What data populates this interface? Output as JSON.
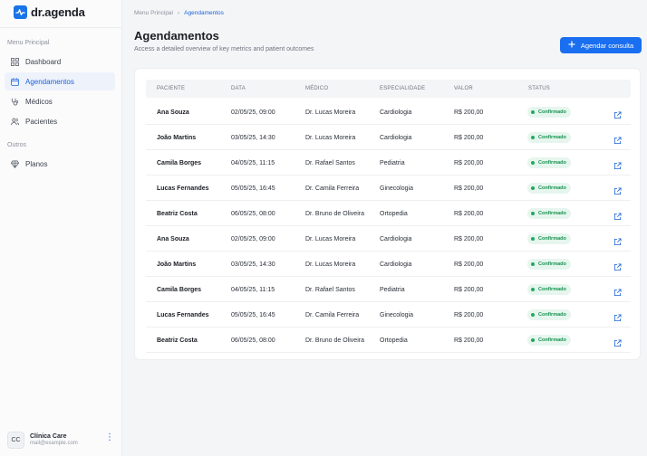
{
  "app": {
    "brand": "dr.agenda"
  },
  "sidebar": {
    "section_main": "Menu Principal",
    "section_other": "Outros",
    "items": [
      {
        "label": "Dashboard",
        "icon": "grid-icon"
      },
      {
        "label": "Agendamentos",
        "icon": "calendar-icon",
        "active": true
      },
      {
        "label": "Médicos",
        "icon": "stethoscope-icon"
      },
      {
        "label": "Pacientes",
        "icon": "users-icon"
      }
    ],
    "other_items": [
      {
        "label": "Planos",
        "icon": "gem-icon"
      }
    ],
    "user": {
      "initials": "CC",
      "name": "Clínica Care",
      "email": "mail@example.com"
    }
  },
  "breadcrumb": {
    "parent": "Menu Principal",
    "current": "Agendamentos"
  },
  "header": {
    "title": "Agendamentos",
    "subtitle": "Access a detailed overview of key metrics and patient outcomes",
    "action_label": "Agendar consulta"
  },
  "table": {
    "columns": [
      "PACIENTE",
      "DATA",
      "MÉDICO",
      "ESPECIALIDADE",
      "VALOR",
      "STATUS"
    ],
    "rows": [
      {
        "paciente": "Ana Souza",
        "data": "02/05/25, 09:00",
        "medico": "Dr. Lucas Moreira",
        "especialidade": "Cardiologia",
        "valor": "R$ 200,00",
        "status": "Confirmado"
      },
      {
        "paciente": "João Martins",
        "data": "03/05/25, 14:30",
        "medico": "Dr. Lucas Moreira",
        "especialidade": "Cardiologia",
        "valor": "R$ 200,00",
        "status": "Confirmado"
      },
      {
        "paciente": "Camila Borges",
        "data": "04/05/25, 11:15",
        "medico": "Dr. Rafael Santos",
        "especialidade": "Pediatria",
        "valor": "R$ 200,00",
        "status": "Confirmado"
      },
      {
        "paciente": "Lucas Fernandes",
        "data": "05/05/25, 16:45",
        "medico": "Dr. Camila Ferreira",
        "especialidade": "Ginecologia",
        "valor": "R$ 200,00",
        "status": "Confirmado"
      },
      {
        "paciente": "Beatriz Costa",
        "data": "06/05/25, 08:00",
        "medico": "Dr. Bruno de Oliveira",
        "especialidade": "Ortopedia",
        "valor": "R$ 200,00",
        "status": "Confirmado"
      },
      {
        "paciente": "Ana Souza",
        "data": "02/05/25, 09:00",
        "medico": "Dr. Lucas Moreira",
        "especialidade": "Cardiologia",
        "valor": "R$ 200,00",
        "status": "Confirmado"
      },
      {
        "paciente": "João Martins",
        "data": "03/05/25, 14:30",
        "medico": "Dr. Lucas Moreira",
        "especialidade": "Cardiologia",
        "valor": "R$ 200,00",
        "status": "Confirmado"
      },
      {
        "paciente": "Camila Borges",
        "data": "04/05/25, 11:15",
        "medico": "Dr. Rafael Santos",
        "especialidade": "Pediatria",
        "valor": "R$ 200,00",
        "status": "Confirmado"
      },
      {
        "paciente": "Lucas Fernandes",
        "data": "05/05/25, 16:45",
        "medico": "Dr. Camila Ferreira",
        "especialidade": "Ginecologia",
        "valor": "R$ 200,00",
        "status": "Confirmado"
      },
      {
        "paciente": "Beatriz Costa",
        "data": "06/05/25, 08:00",
        "medico": "Dr. Bruno de Oliveira",
        "especialidade": "Ortopedia",
        "valor": "R$ 200,00",
        "status": "Confirmado"
      }
    ]
  },
  "colors": {
    "accent": "#1a6ef0",
    "status_ok": "#16924f",
    "status_ok_bg": "#e6f6ee"
  }
}
